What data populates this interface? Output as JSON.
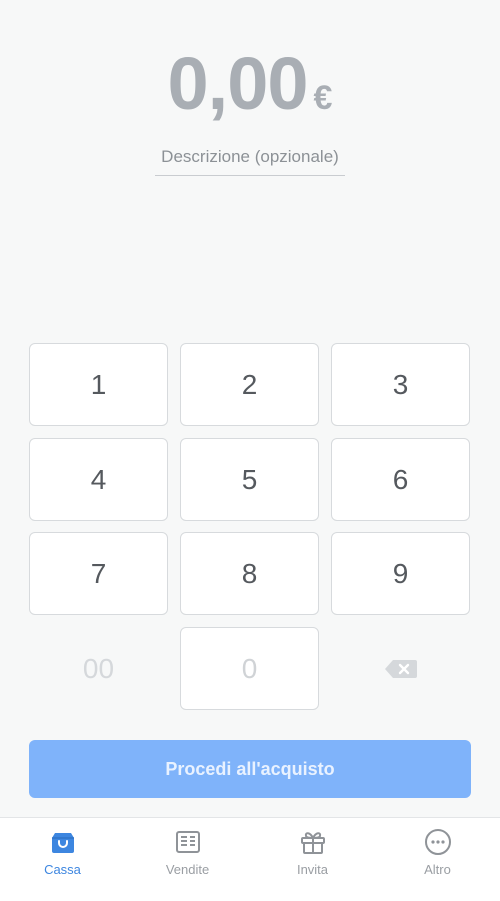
{
  "amount": {
    "value": "0,00",
    "currency": "€"
  },
  "description": {
    "placeholder": "Descrizione (opzionale)",
    "value": ""
  },
  "keypad": {
    "k1": "1",
    "k2": "2",
    "k3": "3",
    "k4": "4",
    "k5": "5",
    "k6": "6",
    "k7": "7",
    "k8": "8",
    "k9": "9",
    "k00": "00",
    "k0": "0"
  },
  "proceed": {
    "label": "Procedi all'acquisto"
  },
  "tabs": [
    {
      "label": "Cassa",
      "icon": "bag-icon",
      "active": true
    },
    {
      "label": "Vendite",
      "icon": "receipt-icon",
      "active": false
    },
    {
      "label": "Invita",
      "icon": "gift-icon",
      "active": false
    },
    {
      "label": "Altro",
      "icon": "more-icon",
      "active": false
    }
  ],
  "colors": {
    "accent": "#3d86e0",
    "button": "#7fb3fa",
    "amount": "#a9aeb4"
  }
}
